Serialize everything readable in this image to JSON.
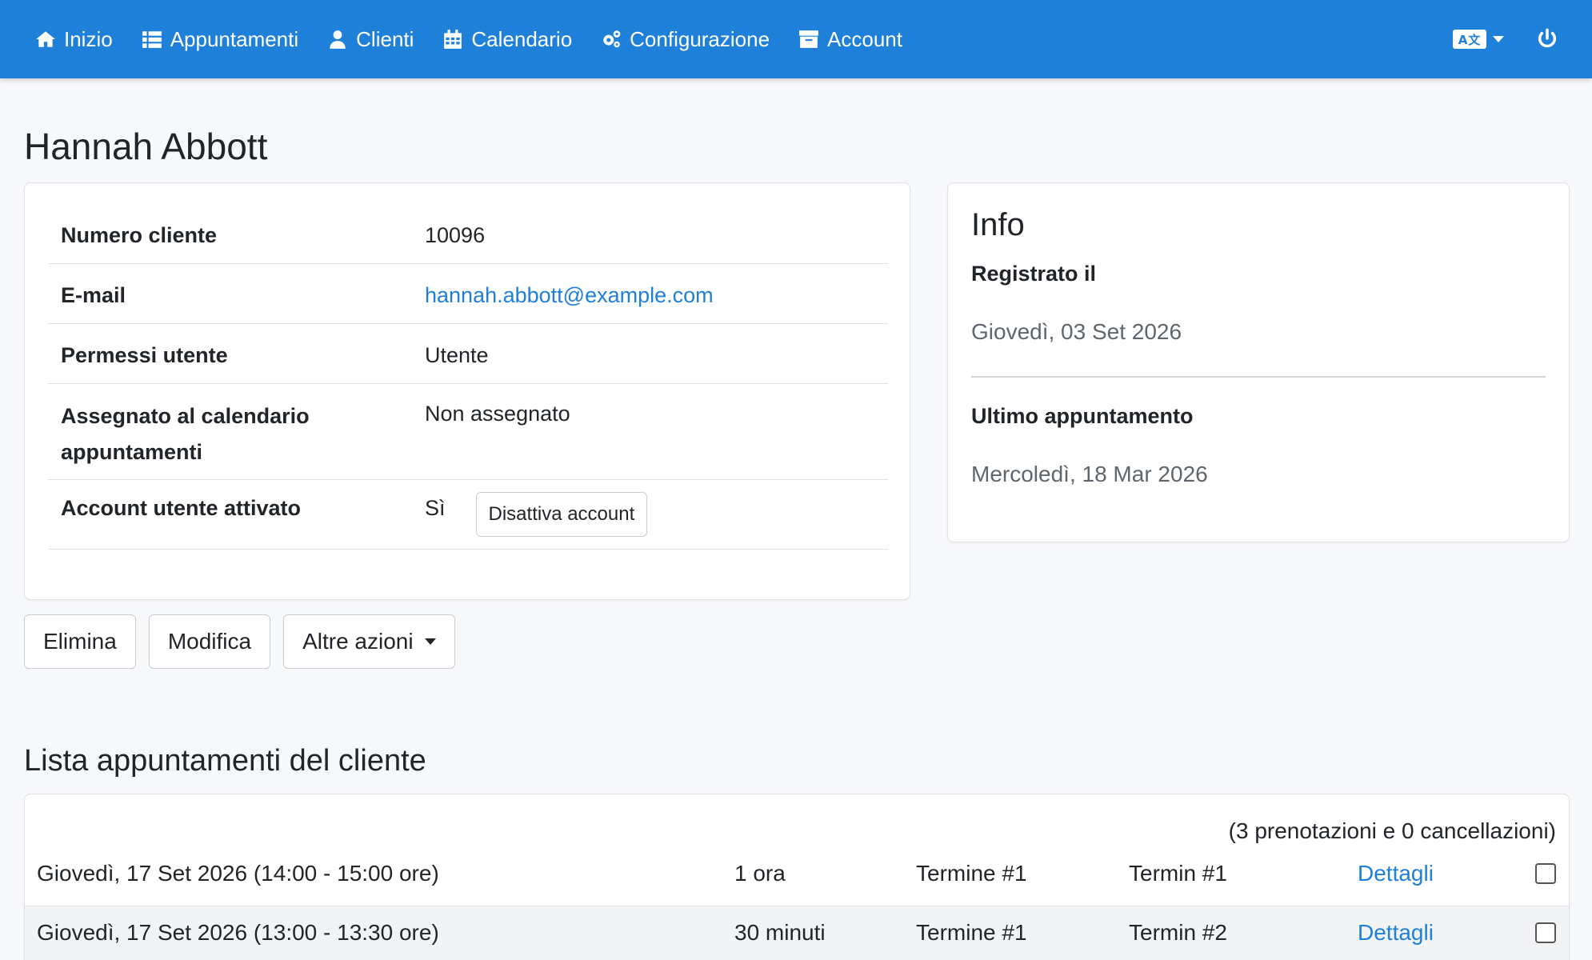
{
  "nav": {
    "items": [
      {
        "label": "Inizio",
        "icon": "home-icon"
      },
      {
        "label": "Appuntamenti",
        "icon": "list-icon"
      },
      {
        "label": "Clienti",
        "icon": "user-icon"
      },
      {
        "label": "Calendario",
        "icon": "calendar-icon"
      },
      {
        "label": "Configurazione",
        "icon": "cogs-icon"
      },
      {
        "label": "Account",
        "icon": "archive-icon"
      }
    ],
    "language_icon": "language-icon",
    "power_icon": "power-icon"
  },
  "customer": {
    "name": "Hannah Abbott",
    "rows": {
      "number": {
        "label": "Numero cliente",
        "value": "10096"
      },
      "email": {
        "label": "E-mail",
        "value": "hannah.abbott@example.com"
      },
      "permissions": {
        "label": "Permessi utente",
        "value": "Utente"
      },
      "calendar": {
        "label": "Assegnato al calendario appuntamenti",
        "value": "Non assegnato"
      },
      "active": {
        "label": "Account utente attivato",
        "value": "Sì",
        "button": "Disattiva account"
      }
    }
  },
  "info": {
    "title": "Info",
    "registered_label": "Registrato il",
    "registered_value": "Giovedì, 03 Set 2026",
    "last_label": "Ultimo appuntamento",
    "last_value": "Mercoledì, 18 Mar 2026"
  },
  "actions": {
    "delete": "Elimina",
    "edit": "Modifica",
    "more": "Altre azioni"
  },
  "appointments": {
    "title": "Lista appuntamenti del cliente",
    "summary": "(3 prenotazioni e 0 cancellazioni)",
    "rows": [
      {
        "date": "Giovedì, 17 Set 2026 (14:00 - 15:00 ore)",
        "duration": "1 ora",
        "service": "Termine #1",
        "provider": "Termin #1",
        "details": "Dettagli"
      },
      {
        "date": "Giovedì, 17 Set 2026 (13:00 - 13:30 ore)",
        "duration": "30 minuti",
        "service": "Termine #1",
        "provider": "Termin #2",
        "details": "Dettagli"
      }
    ]
  }
}
